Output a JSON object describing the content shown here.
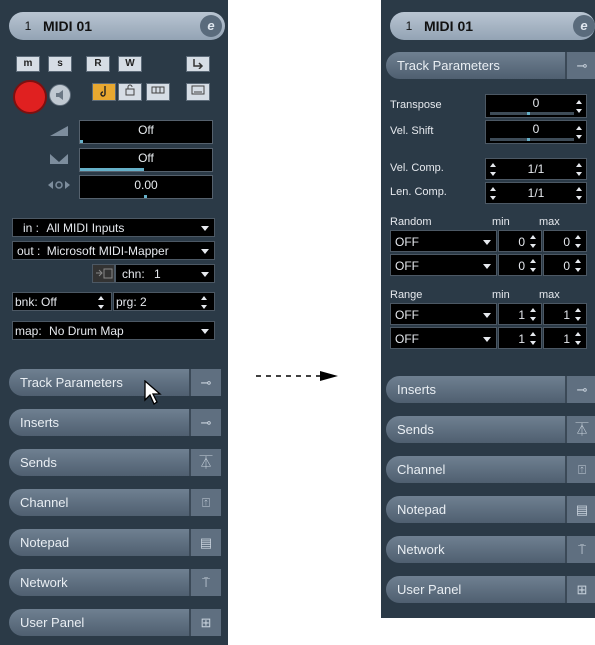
{
  "left": {
    "track": {
      "number": "1",
      "name": "MIDI 01",
      "edit": "e"
    },
    "buttons": {
      "m": "m",
      "s": "s",
      "r": "R",
      "w": "W"
    },
    "volume": "Off",
    "pan": "Off",
    "delay": "0.00",
    "input": {
      "label": "in :",
      "value": "All MIDI Inputs"
    },
    "output": {
      "label": "out :",
      "value": "Microsoft MIDI-Mapper"
    },
    "channel": {
      "label": "chn:",
      "value": "1"
    },
    "bank": {
      "label": "bnk:",
      "value": "Off"
    },
    "program": {
      "label": "prg:",
      "value": "2"
    },
    "map": {
      "label": "map:",
      "value": "No Drum Map"
    },
    "sections": [
      "Track Parameters",
      "Inserts",
      "Sends",
      "Channel",
      "Notepad",
      "Network",
      "User Panel"
    ]
  },
  "right": {
    "track": {
      "number": "1",
      "name": "MIDI 01",
      "edit": "e"
    },
    "track_params_title": "Track Parameters",
    "transpose": {
      "label": "Transpose",
      "value": "0"
    },
    "vel_shift": {
      "label": "Vel. Shift",
      "value": "0"
    },
    "vel_comp": {
      "label": "Vel. Comp.",
      "value": "1/1"
    },
    "len_comp": {
      "label": "Len. Comp.",
      "value": "1/1"
    },
    "random": {
      "label": "Random",
      "min": "min",
      "max": "max",
      "rows": [
        {
          "mode": "OFF",
          "min": "0",
          "max": "0"
        },
        {
          "mode": "OFF",
          "min": "0",
          "max": "0"
        }
      ]
    },
    "range": {
      "label": "Range",
      "min": "min",
      "max": "max",
      "rows": [
        {
          "mode": "OFF",
          "min": "1",
          "max": "1"
        },
        {
          "mode": "OFF",
          "min": "1",
          "max": "1"
        }
      ]
    },
    "sections": [
      "Inserts",
      "Sends",
      "Channel",
      "Notepad",
      "Network",
      "User Panel"
    ]
  },
  "colors": {
    "panel": "#2b3a47",
    "record": "#e02020",
    "accent": "#66b0c8"
  },
  "icons": {
    "section_toggle": "fold-icon",
    "cursor": "pointer-arrow-icon"
  }
}
